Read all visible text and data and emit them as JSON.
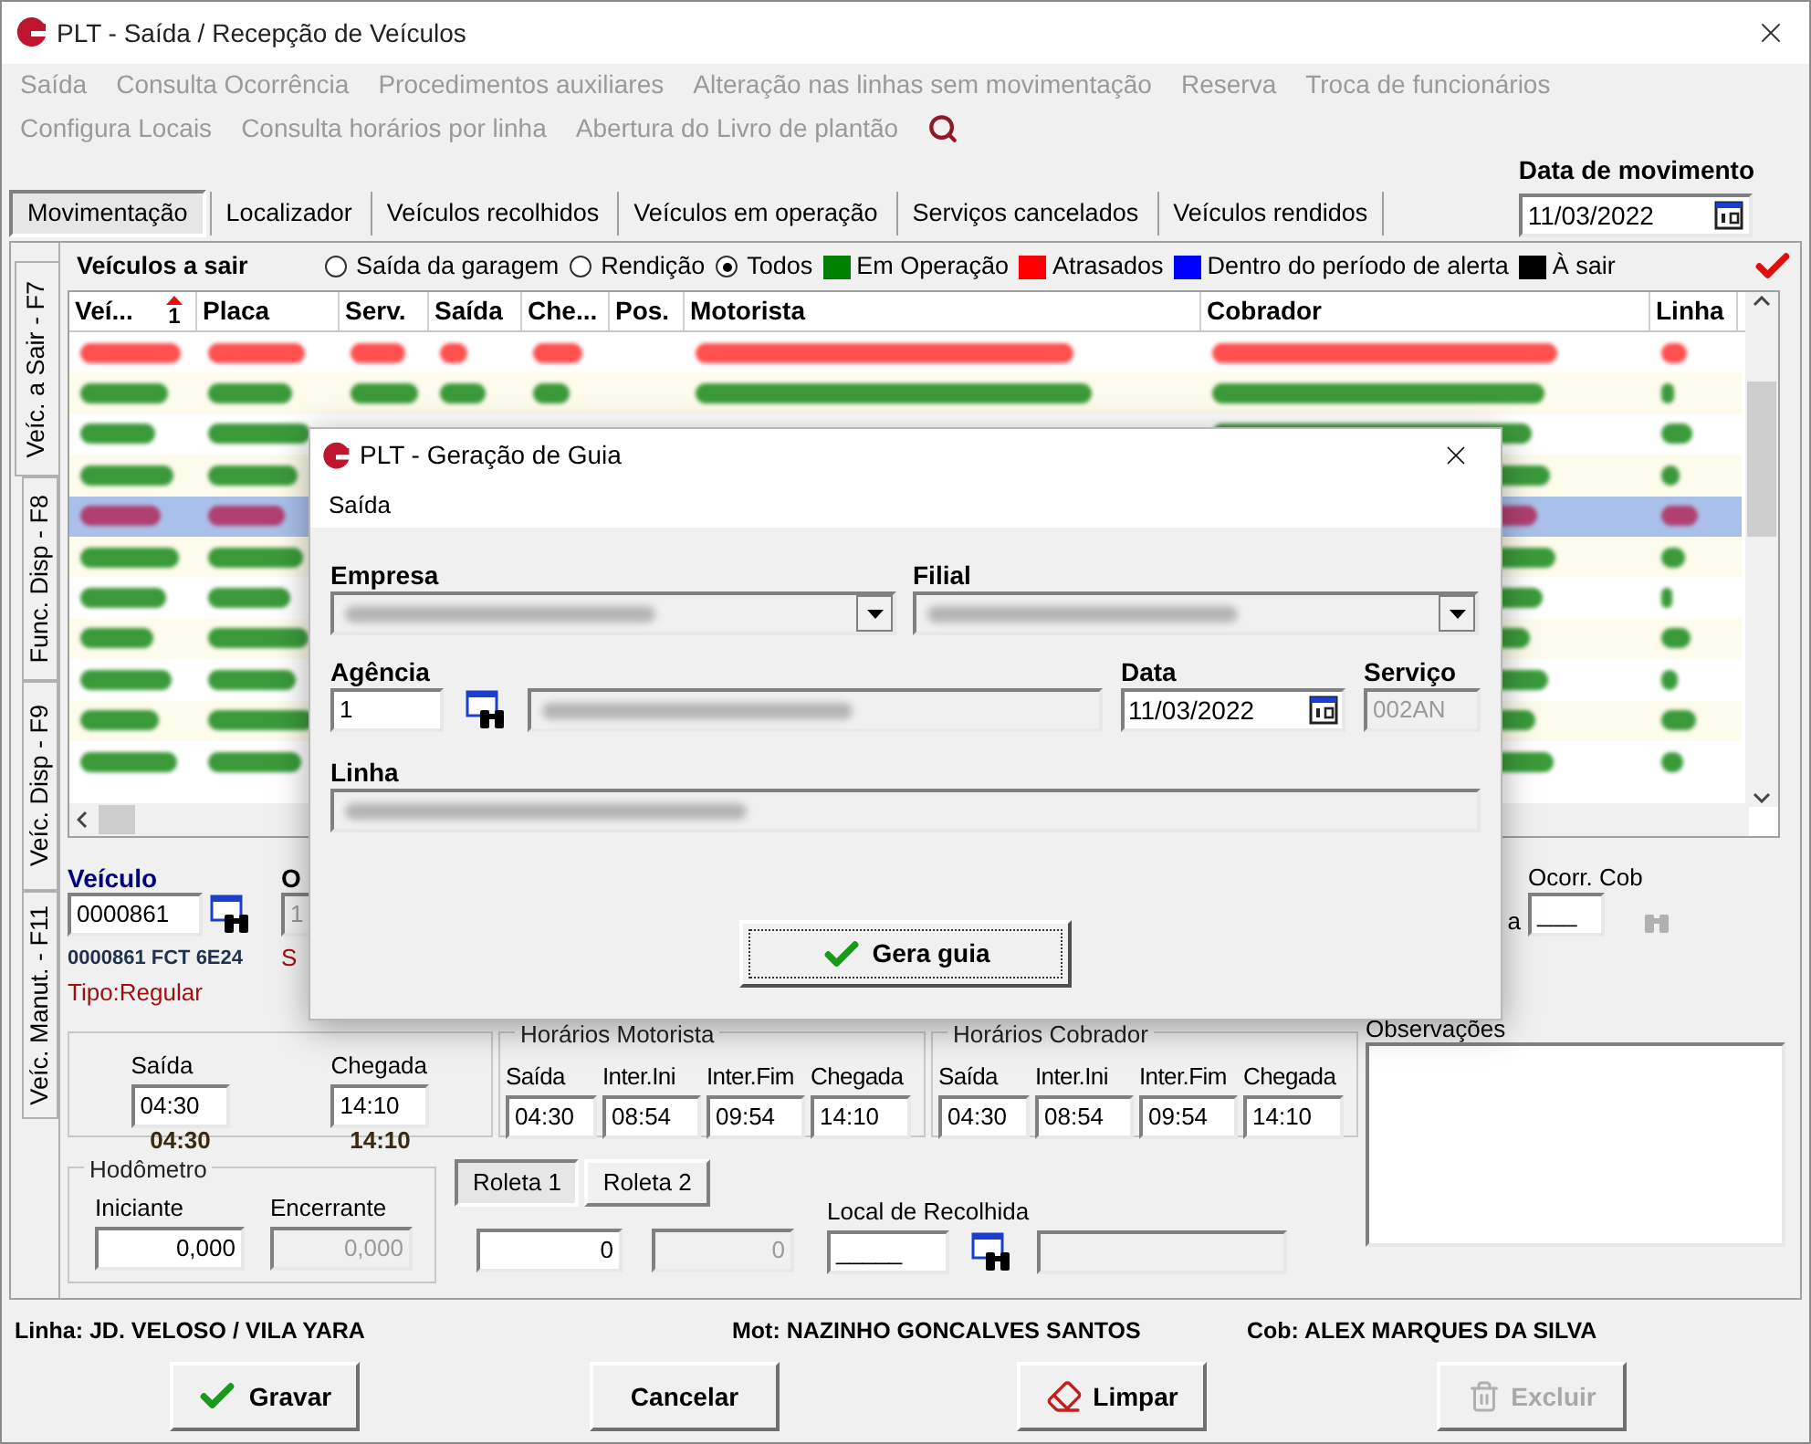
{
  "window": {
    "title": "PLT - Saída / Recepção de Veículos"
  },
  "menu": [
    [
      "Saída",
      "Consulta Ocorrência",
      "Procedimentos auxiliares",
      "Alteração nas linhas sem movimentação",
      "Reserva",
      "Troca de funcionários"
    ],
    [
      "Configura Locais",
      "Consulta horários por linha",
      "Abertura do Livro de plantão"
    ]
  ],
  "tabs": [
    {
      "label": "Movimentação",
      "selected": true
    },
    {
      "label": "Localizador",
      "selected": false
    },
    {
      "label": "Veículos recolhidos",
      "selected": false
    },
    {
      "label": "Veículos em operação",
      "selected": false
    },
    {
      "label": "Serviços cancelados",
      "selected": false
    },
    {
      "label": "Veículos rendidos",
      "selected": false
    }
  ],
  "movement_date": {
    "label": "Data de movimento",
    "value": "11/03/2022"
  },
  "side_tabs": [
    {
      "label": "Veíc. a Sair - F7",
      "selected": true
    },
    {
      "label": "Func. Disp - F8",
      "selected": false
    },
    {
      "label": "Veíc. Disp - F9",
      "selected": false
    },
    {
      "label": "Veíc. Manut. - F11",
      "selected": false
    }
  ],
  "list": {
    "title": "Veículos a sair",
    "filters": [
      {
        "label": "Saída da garagem",
        "selected": false
      },
      {
        "label": "Rendição",
        "selected": false
      },
      {
        "label": "Todos",
        "selected": true
      }
    ],
    "legend": [
      {
        "label": "Em Operação",
        "color": "#008000"
      },
      {
        "label": "Atrasados",
        "color": "#ff0000"
      },
      {
        "label": "Dentro do período de alerta",
        "color": "#0000ff"
      },
      {
        "label": "À sair",
        "color": "#000000"
      }
    ],
    "columns": [
      {
        "label": "Veí...",
        "sort_index": "1"
      },
      {
        "label": "Placa"
      },
      {
        "label": "Serv."
      },
      {
        "label": "Saída"
      },
      {
        "label": "Che..."
      },
      {
        "label": "Pos."
      },
      {
        "label": "Motorista"
      },
      {
        "label": "Cobrador"
      },
      {
        "label": "Linha"
      }
    ],
    "rows": [
      {
        "color": "#ff5050",
        "selected": false
      },
      {
        "color": "#3a9a3a",
        "selected": false
      },
      {
        "color": "#3a9a3a",
        "selected": false
      },
      {
        "color": "#3a9a3a",
        "selected": false
      },
      {
        "color": "#b04070",
        "selected": true
      },
      {
        "color": "#3a9a3a",
        "selected": false
      },
      {
        "color": "#3a9a3a",
        "selected": false
      },
      {
        "color": "#3a9a3a",
        "selected": false
      },
      {
        "color": "#3a9a3a",
        "selected": false
      },
      {
        "color": "#3a9a3a",
        "selected": false
      },
      {
        "color": "#3a9a3a",
        "selected": false
      }
    ]
  },
  "vehicle": {
    "label": "Veículo",
    "value": "0000861",
    "plate": "0000861 FCT 6E24",
    "type": "Tipo:Regular"
  },
  "hidden_fragments": {
    "label": "O",
    "field": "1",
    "text": "S",
    "label_2": "a"
  },
  "schedule": {
    "fields": [
      {
        "label": "Saída",
        "value": "04:30",
        "actual": "04:30"
      },
      {
        "label": "Chegada",
        "value": "14:10",
        "actual": "14:10"
      }
    ]
  },
  "driver_hours": {
    "title": "Horários Motorista",
    "fields": [
      {
        "label": "Saída",
        "value": "04:30"
      },
      {
        "label": "Inter.Ini",
        "value": "08:54"
      },
      {
        "label": "Inter.Fim",
        "value": "09:54"
      },
      {
        "label": "Chegada",
        "value": "14:10"
      }
    ]
  },
  "collector_hours": {
    "title": "Horários Cobrador",
    "fields": [
      {
        "label": "Saída",
        "value": "04:30"
      },
      {
        "label": "Inter.Ini",
        "value": "08:54"
      },
      {
        "label": "Inter.Fim",
        "value": "09:54"
      },
      {
        "label": "Chegada",
        "value": "14:10"
      }
    ]
  },
  "occurrence": {
    "label": "Ocorr. Cob",
    "value": "___"
  },
  "notes": {
    "label": "Observações"
  },
  "odometer": {
    "title": "Hodômetro",
    "fields": [
      {
        "label": "Iniciante",
        "value": "0,000",
        "disabled": false
      },
      {
        "label": "Encerrante",
        "value": "0,000",
        "disabled": true
      }
    ]
  },
  "turnstiles": {
    "tabs": [
      {
        "label": "Roleta 1",
        "selected": true
      },
      {
        "label": "Roleta 2",
        "selected": false
      }
    ],
    "fields": [
      {
        "value": "0",
        "disabled": false
      },
      {
        "value": "0",
        "disabled": true
      }
    ]
  },
  "return_place": {
    "label": "Local de Recolhida",
    "value": "_____"
  },
  "summary": [
    "Linha: JD. VELOSO / VILA YARA",
    "Mot: NAZINHO GONCALVES SANTOS",
    "Cob: ALEX MARQUES DA SILVA"
  ],
  "buttons": [
    {
      "label": "Gravar",
      "kind": "save",
      "disabled": false
    },
    {
      "label": "Cancelar",
      "kind": "cancel",
      "disabled": false
    },
    {
      "label": "Limpar",
      "kind": "clear",
      "disabled": false
    },
    {
      "label": "Excluir",
      "kind": "delete",
      "disabled": true
    }
  ],
  "dialog": {
    "title": "PLT - Geração de Guia",
    "menu": "Saída",
    "company": {
      "label": "Empresa"
    },
    "branch": {
      "label": "Filial"
    },
    "agency": {
      "label": "Agência",
      "value": "1"
    },
    "date": {
      "label": "Data",
      "value": "11/03/2022"
    },
    "service": {
      "label": "Serviço",
      "value": "002AN"
    },
    "line": {
      "label": "Linha"
    },
    "button": "Gera guia"
  }
}
